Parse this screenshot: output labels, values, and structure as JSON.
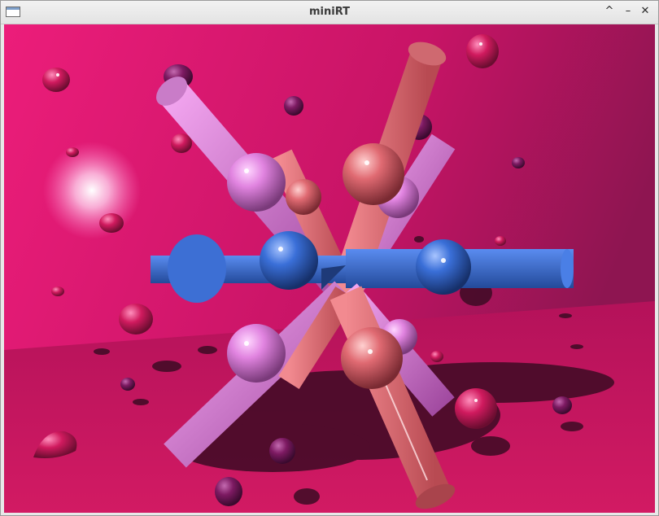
{
  "window": {
    "title": "miniRT",
    "controls": {
      "maximize": "^",
      "minimize": "–",
      "close": "✕"
    }
  },
  "scene": {
    "background_color": "#e0156f",
    "floor_color": "#c3145c",
    "colors": {
      "pink": "#e184e0",
      "salmon": "#e06a72",
      "blue": "#3a6fd8",
      "magenta": "#d81a62",
      "plum": "#8a1a6a"
    }
  }
}
